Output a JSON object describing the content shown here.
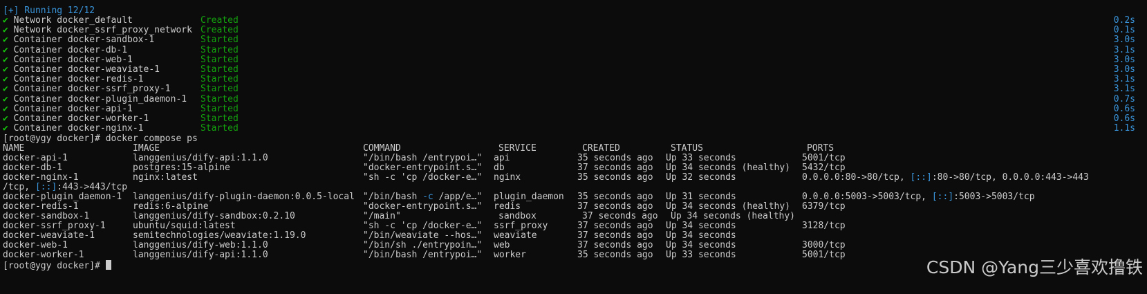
{
  "status_header": "[+] Running 12/12",
  "check_glyph": "✔",
  "compose_events": [
    {
      "name": "Network docker_default",
      "state": "Created",
      "time": "0.2s"
    },
    {
      "name": "Network docker_ssrf_proxy_network",
      "state": "Created",
      "time": "0.1s"
    },
    {
      "name": "Container docker-sandbox-1",
      "state": "Started",
      "time": "3.0s"
    },
    {
      "name": "Container docker-db-1",
      "state": "Started",
      "time": "3.1s"
    },
    {
      "name": "Container docker-web-1",
      "state": "Started",
      "time": "3.0s"
    },
    {
      "name": "Container docker-weaviate-1",
      "state": "Started",
      "time": "3.0s"
    },
    {
      "name": "Container docker-redis-1",
      "state": "Started",
      "time": "3.1s"
    },
    {
      "name": "Container docker-ssrf_proxy-1",
      "state": "Started",
      "time": "3.1s"
    },
    {
      "name": "Container docker-plugin_daemon-1",
      "state": "Started",
      "time": "0.7s"
    },
    {
      "name": "Container docker-api-1",
      "state": "Started",
      "time": "0.6s"
    },
    {
      "name": "Container docker-worker-1",
      "state": "Started",
      "time": "0.6s"
    },
    {
      "name": "Container docker-nginx-1",
      "state": "Started",
      "time": "1.1s"
    }
  ],
  "prompt": "[root@ygy docker]# ",
  "command": "docker compose ps",
  "ps_headers": {
    "name": "NAME",
    "image": "IMAGE",
    "command": "COMMAND",
    "service": "SERVICE",
    "created": "CREATED",
    "status": "STATUS",
    "ports": "PORTS"
  },
  "ps_rows": [
    {
      "name": "docker-api-1",
      "image": "langgenius/dify-api:1.1.0",
      "command": "\"/bin/bash /entrypoi…\"",
      "service": "api",
      "created": "35 seconds ago",
      "status": "Up 33 seconds",
      "ports": "5001/tcp"
    },
    {
      "name": "docker-db-1",
      "image": "postgres:15-alpine",
      "command": "\"docker-entrypoint.s…\"",
      "service": "db",
      "created": "37 seconds ago",
      "status": "Up 34 seconds (healthy)",
      "ports": "5432/tcp"
    },
    {
      "name": "docker-nginx-1",
      "image": "nginx:latest",
      "command": "\"sh -c 'cp /docker-e…\"",
      "service": "nginx",
      "created": "35 seconds ago",
      "status": "Up 32 seconds",
      "ports_a": "0.0.0.0:80->80/tcp, ",
      "ports_b": "[::]",
      "ports_c": ":80->80/tcp, 0.0.0.0:443->443",
      "ports_wrap_a": "/tcp, ",
      "ports_wrap_b": "[::]",
      "ports_wrap_c": ":443->443/tcp"
    },
    {
      "name": "docker-plugin_daemon-1",
      "image": "langgenius/dify-plugin-daemon:0.0.5-local",
      "command": "\"/bin/bash -c /app/e…\"",
      "service": "plugin_daemon",
      "created": "35 seconds ago",
      "status": "Up 31 seconds",
      "ports_a": "0.0.0.0:5003->5003/tcp, ",
      "ports_b": "[::]",
      "ports_c": ":5003->5003/tcp"
    },
    {
      "name": "docker-redis-1",
      "image": "redis:6-alpine",
      "command": "\"docker-entrypoint.s…\"",
      "service": "redis",
      "created": "37 seconds ago",
      "status": "Up 34 seconds (healthy)",
      "ports": "6379/tcp"
    },
    {
      "name": "docker-sandbox-1",
      "image": "langgenius/dify-sandbox:0.2.10",
      "command": "\"/main\"",
      "service": "sandbox",
      "created": "37 seconds ago",
      "status": "Up 34 seconds (healthy)",
      "ports": ""
    },
    {
      "name": "docker-ssrf_proxy-1",
      "image": "ubuntu/squid:latest",
      "command": "\"sh -c 'cp /docker-e…\"",
      "service": "ssrf_proxy",
      "created": "37 seconds ago",
      "status": "Up 34 seconds",
      "ports": "3128/tcp"
    },
    {
      "name": "docker-weaviate-1",
      "image": "semitechnologies/weaviate:1.19.0",
      "command": "\"/bin/weaviate --hos…\"",
      "service": "weaviate",
      "created": "37 seconds ago",
      "status": "Up 34 seconds",
      "ports": ""
    },
    {
      "name": "docker-web-1",
      "image": "langgenius/dify-web:1.1.0",
      "command": "\"/bin/sh ./entrypoin…\"",
      "service": "web",
      "created": "37 seconds ago",
      "status": "Up 34 seconds",
      "ports": "3000/tcp"
    },
    {
      "name": "docker-worker-1",
      "image": "langgenius/dify-api:1.1.0",
      "command": "\"/bin/bash /entrypoi…\"",
      "service": "worker",
      "created": "35 seconds ago",
      "status": "Up 33 seconds",
      "ports": "5001/tcp"
    }
  ],
  "watermark": "CSDN @Yang三少喜欢撸铁",
  "colors": {
    "background": "#0c0c0c",
    "foreground": "#cccccc",
    "accent_blue": "#3a96dd",
    "success_green": "#13a10e"
  }
}
